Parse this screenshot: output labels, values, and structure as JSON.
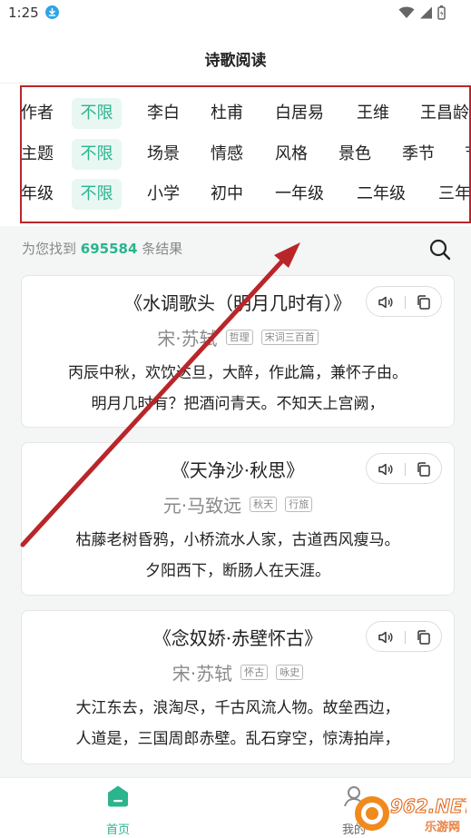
{
  "status_bar": {
    "time": "1:25"
  },
  "header": {
    "title": "诗歌阅读"
  },
  "filters": {
    "author": {
      "label": "作者",
      "options": [
        "不限",
        "李白",
        "杜甫",
        "白居易",
        "王维",
        "王昌龄"
      ]
    },
    "theme": {
      "label": "主题",
      "options": [
        "不限",
        "场景",
        "情感",
        "风格",
        "景色",
        "季节",
        "节"
      ]
    },
    "grade": {
      "label": "年级",
      "options": [
        "不限",
        "小学",
        "初中",
        "一年级",
        "二年级",
        "三年"
      ]
    }
  },
  "results": {
    "prefix": "为您找到",
    "count": "695584",
    "suffix": "条结果"
  },
  "poems": [
    {
      "title": "《水调歌头（明月几时有）》",
      "author": "宋·苏轼",
      "tags": [
        "哲理",
        "宋词三百首"
      ],
      "lines": [
        "丙辰中秋，欢饮达旦，大醉，作此篇，兼怀子由。",
        "明月几时有？把酒问青天。不知天上宫阙，"
      ]
    },
    {
      "title": "《天净沙·秋思》",
      "author": "元·马致远",
      "tags": [
        "秋天",
        "行旅"
      ],
      "lines": [
        "枯藤老树昏鸦，小桥流水人家，古道西风瘦马。",
        "夕阳西下，断肠人在天涯。"
      ]
    },
    {
      "title": "《念奴娇·赤壁怀古》",
      "author": "宋·苏轼",
      "tags": [
        "怀古",
        "咏史"
      ],
      "lines": [
        "大江东去，浪淘尽，千古风流人物。故垒西边，",
        "人道是，三国周郎赤壁。乱石穿空，惊涛拍岸，"
      ]
    }
  ],
  "bottom_nav": {
    "home": "首页",
    "mine": "我的"
  },
  "watermark": {
    "brand": "962.NET",
    "sub": "乐游网"
  },
  "colors": {
    "accent": "#2bb48e",
    "annotation": "#b9262a"
  }
}
